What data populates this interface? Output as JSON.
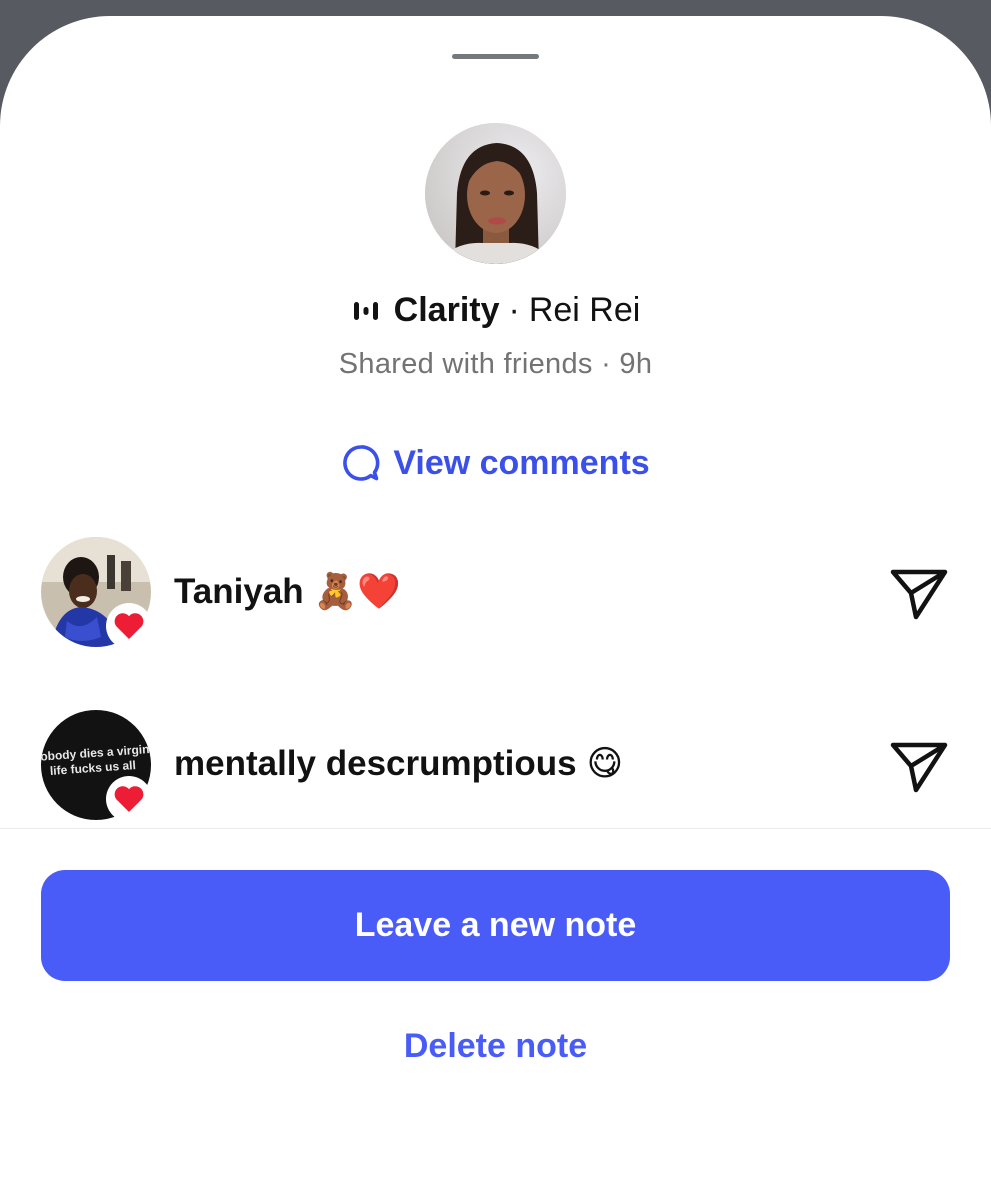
{
  "note": {
    "song": "Clarity",
    "separator": "·",
    "artist": "Rei Rei",
    "audience": "Shared with friends",
    "age": "9h"
  },
  "actions": {
    "view_comments": "View comments",
    "leave_new_note": "Leave a new note",
    "delete_note": "Delete note"
  },
  "reactions": [
    {
      "name": "Taniyah",
      "emoji": "🧸❤️",
      "reaction": "heart"
    },
    {
      "name": "mentally descrumptious",
      "emoji": "😋",
      "reaction": "heart",
      "avatar_text": [
        "nobody dies a virgin,",
        "life fucks us all"
      ]
    }
  ],
  "icons": {
    "music": "music-bars-icon",
    "comment": "comment-bubble-icon",
    "send": "send-paper-plane-icon",
    "heart": "heart-icon"
  },
  "colors": {
    "accent": "#4a5cf7",
    "link": "#3b50e8",
    "heart": "#ee1d36",
    "secondary_text": "#737373"
  }
}
